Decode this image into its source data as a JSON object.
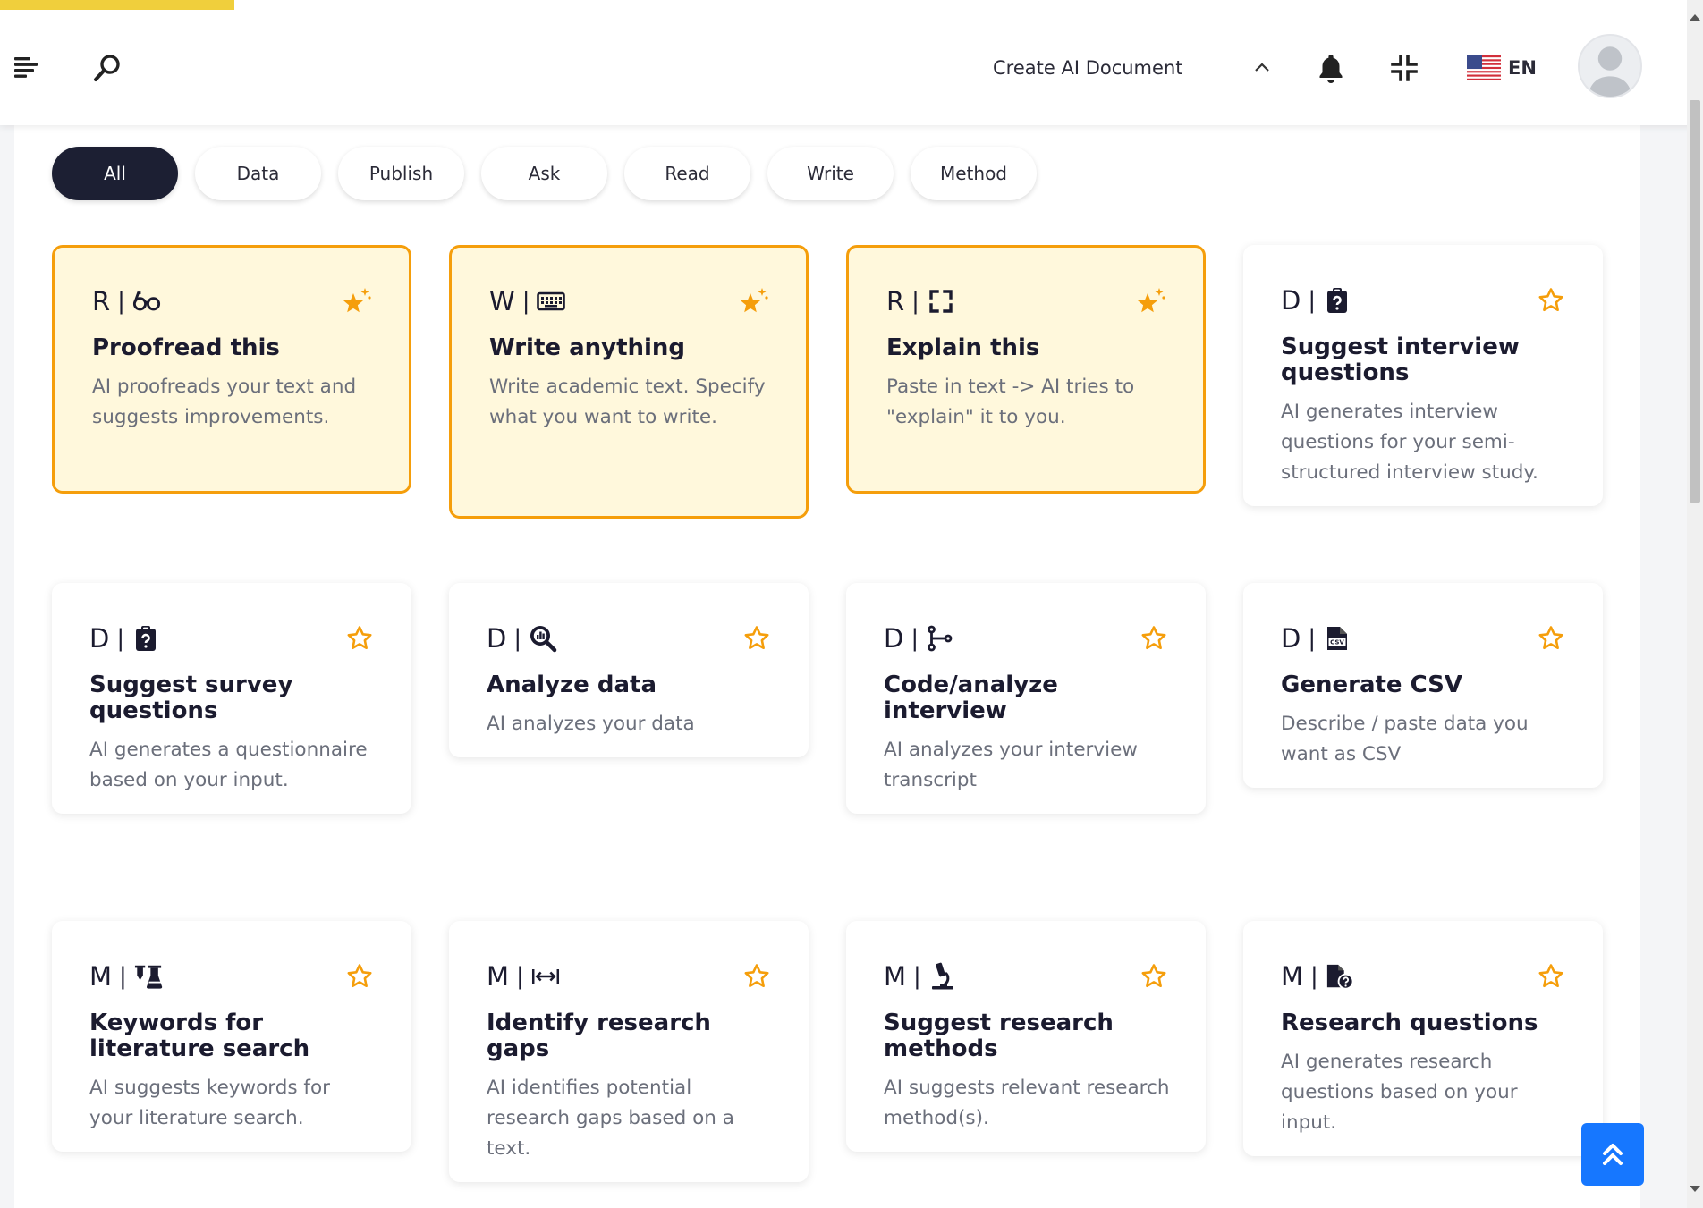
{
  "header": {
    "create_label": "Create AI Document",
    "language": "EN"
  },
  "filters": [
    {
      "label": "All",
      "active": true
    },
    {
      "label": "Data"
    },
    {
      "label": "Publish"
    },
    {
      "label": "Ask"
    },
    {
      "label": "Read"
    },
    {
      "label": "Write"
    },
    {
      "label": "Method"
    }
  ],
  "cards": [
    {
      "code": "R",
      "icon": "glasses-icon",
      "title": "Proofread this",
      "desc": "AI proofreads your text and suggests improvements.",
      "featured": true
    },
    {
      "code": "W",
      "icon": "keyboard-icon",
      "title": "Write anything",
      "desc": "Write academic text. Specify what you want to write.",
      "featured": true
    },
    {
      "code": "R",
      "icon": "expand-icon",
      "title": "Explain this",
      "desc": "Paste in text -> AI tries to \"explain\" it to you.",
      "featured": true
    },
    {
      "code": "D",
      "icon": "clipboard-question-icon",
      "title": "Suggest interview questions",
      "desc": "AI generates interview questions for your semi-structured interview study."
    },
    {
      "code": "D",
      "icon": "clipboard-question-icon",
      "title": "Suggest survey questions",
      "desc": "AI generates a questionnaire based on your input."
    },
    {
      "code": "D",
      "icon": "magnifier-chart-icon",
      "title": "Analyze data",
      "desc": "AI analyzes your data"
    },
    {
      "code": "D",
      "icon": "branch-icon",
      "title": "Code/analyze interview",
      "desc": "AI analyzes your interview transcript"
    },
    {
      "code": "D",
      "icon": "csv-file-icon",
      "title": "Generate CSV",
      "desc": "Describe / paste data you want as CSV"
    },
    {
      "code": "M",
      "icon": "flask-icon",
      "title": "Keywords for literature search",
      "desc": "AI suggests keywords for your literature search."
    },
    {
      "code": "M",
      "icon": "arrows-gap-icon",
      "title": "Identify research gaps",
      "desc": "AI identifies potential research gaps based on a text."
    },
    {
      "code": "M",
      "icon": "microscope-icon",
      "title": "Suggest research methods",
      "desc": "AI suggests relevant research method(s)."
    },
    {
      "code": "M",
      "icon": "file-question-icon",
      "title": "Research questions",
      "desc": "AI generates research questions based on your input."
    }
  ],
  "colors": {
    "accent_yellow": "#f0cf3c",
    "featured_border": "#f59e0b",
    "featured_bg": "#fff8dc",
    "active_chip": "#1c1f33",
    "to_top_button": "#1677ff"
  }
}
